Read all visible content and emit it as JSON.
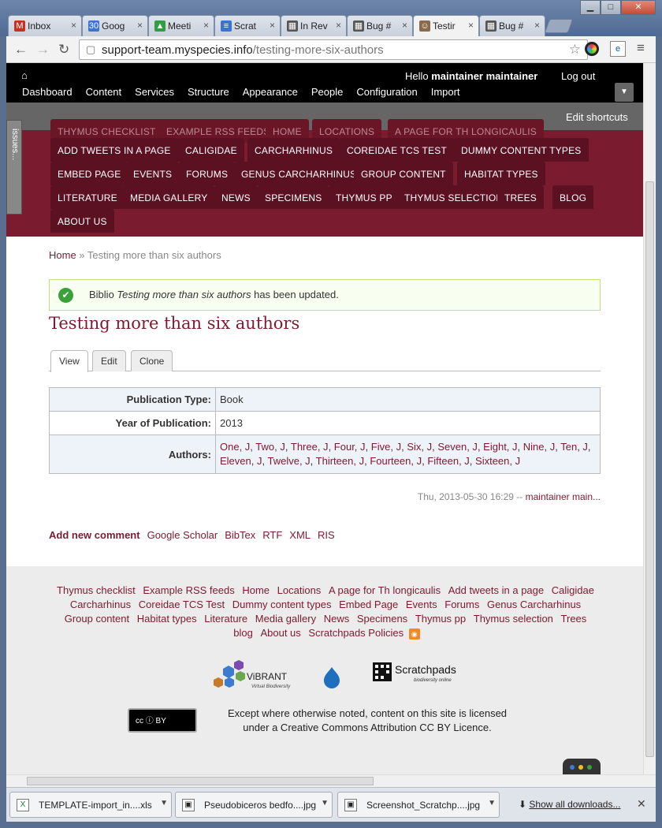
{
  "browser": {
    "tabs": [
      {
        "label": "Inbox",
        "icon": "M",
        "color": "#c23321"
      },
      {
        "label": "Goog",
        "icon": "30",
        "color": "#3b73d3"
      },
      {
        "label": "Meeti",
        "icon": "▲",
        "color": "#2f9e44"
      },
      {
        "label": "Scrat",
        "icon": "≡",
        "color": "#3b73d3"
      },
      {
        "label": "In Rev",
        "icon": "▦",
        "color": "#555"
      },
      {
        "label": "Bug #",
        "icon": "▦",
        "color": "#555"
      },
      {
        "label": "Testir",
        "icon": "☺",
        "color": "#8a6a4a"
      },
      {
        "label": "Bug #",
        "icon": "▦",
        "color": "#555"
      }
    ],
    "url_domain": "support-team.myspecies.info",
    "url_path": "/testing-more-six-authors"
  },
  "admin": {
    "hello_prefix": "Hello ",
    "user": "maintainer maintainer",
    "logout": "Log out",
    "menu": [
      "Dashboard",
      "Content",
      "Services",
      "Structure",
      "Appearance",
      "People",
      "Configuration",
      "Import"
    ],
    "edit_shortcuts": "Edit shortcuts",
    "issues_tab": "issues..."
  },
  "menu_tabs": {
    "row0": [
      "THYMUS CHECKLIST",
      "EXAMPLE RSS FEEDS",
      "HOME",
      "LOCATIONS",
      "A PAGE FOR TH LONGICAULIS"
    ],
    "row1": [
      "ADD TWEETS IN A PAGE",
      "CALIGIDAE",
      "CARCHARHINUS",
      "COREIDAE TCS TEST",
      "DUMMY CONTENT TYPES"
    ],
    "row2": [
      "EMBED PAGE",
      "EVENTS",
      "FORUMS",
      "GENUS CARCHARHINUS",
      "GROUP CONTENT",
      "HABITAT TYPES"
    ],
    "row3": [
      "LITERATURE",
      "MEDIA GALLERY",
      "NEWS",
      "SPECIMENS",
      "THYMUS PP",
      "THYMUS SELECTION",
      "TREES",
      "BLOG"
    ],
    "row4": [
      "ABOUT US"
    ]
  },
  "breadcrumb": {
    "home": "Home",
    "sep": " » ",
    "current": "Testing more than six authors"
  },
  "status_message": {
    "prefix": "Biblio ",
    "title": "Testing more than six authors",
    "suffix": " has been updated."
  },
  "page_title": "Testing more than six authors",
  "page_tabs": [
    "View",
    "Edit",
    "Clone"
  ],
  "biblio": {
    "pub_type_label": "Publication Type:",
    "pub_type": "Book",
    "year_label": "Year of Publication:",
    "year": "2013",
    "authors_label": "Authors:",
    "authors": [
      "One, J",
      "Two, J",
      "Three, J",
      "Four, J",
      "Five, J",
      "Six, J",
      "Seven, J",
      "Eight, J",
      "Nine, J",
      "Ten, J",
      "Eleven, J",
      "Twelve, J",
      "Thirteen, J",
      "Fourteen, J",
      "Fifteen, J",
      "Sixteen, J"
    ]
  },
  "submitted": {
    "date": "Thu, 2013-05-30 16:29 -- ",
    "user": "maintainer main..."
  },
  "node_links": [
    "Add new comment",
    "Google Scholar",
    "BibTex",
    "RTF",
    "XML",
    "RIS"
  ],
  "footer": {
    "links": [
      "Thymus checklist",
      "Example RSS feeds",
      "Home",
      "Locations",
      "A page for Th longicaulis",
      "Add tweets in a page",
      "Caligidae",
      "Carcharhinus",
      "Coreidae TCS Test",
      "Dummy content types",
      "Embed Page",
      "Events",
      "Forums",
      "Genus Carcharhinus",
      "Group content",
      "Habitat types",
      "Literature",
      "Media gallery",
      "News",
      "Specimens",
      "Thymus pp",
      "Thymus selection",
      "Trees",
      "blog",
      "About us",
      "Scratchpads Policies"
    ],
    "vibrant": "ViBRANT",
    "vibrant_sub": "Virtual Biodiversity",
    "scratchpads": "Scratchpads",
    "scratchpads_sub": "biodiversity online",
    "cc_badge": "cc  ⓘ BY",
    "license_line1": "Except where otherwise noted, content on this site is licensed",
    "license_line2": "under a Creative Commons Attribution CC BY Licence."
  },
  "downloads": {
    "items": [
      "TEMPLATE-import_in....xls",
      "Pseudobiceros bedfo....jpg",
      "Screenshot_Scratchp....jpg"
    ],
    "show_all": "Show all downloads..."
  },
  "colors": {
    "brand": "#7b1b30",
    "tab_dark": "#5c1122",
    "success_bg": "#f8fff0"
  }
}
